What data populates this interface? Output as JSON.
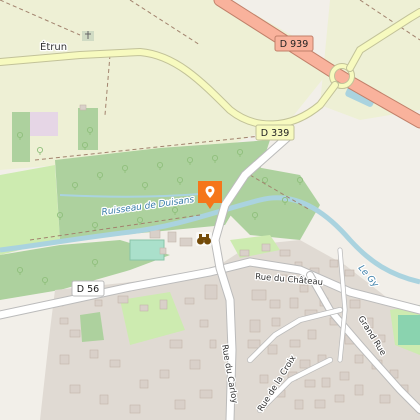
{
  "map": {
    "labels": {
      "village_north": "Étrun",
      "stream": "Ruisseau de Duisans",
      "river": "Le Gy",
      "street_chateau": "Rue du Château",
      "street_carloy": "Rue du Carloy",
      "street_croix": "Rue de la Croix",
      "street_grand": "Grand Rue"
    },
    "road_shields": {
      "d939": "D 939",
      "d339": "D 339",
      "d56": "D 56"
    },
    "marker": {
      "icon": "map-pin-icon",
      "color": "#f5761a"
    },
    "poi": {
      "icon": "binoculars-icon"
    },
    "colors": {
      "background": "#f2efe9",
      "meadow": "#eef0d5",
      "forest": "#add19e",
      "grass": "#cdebb0",
      "water": "#aad3df",
      "built": "#d9d0c9",
      "trunk_road": "#f9b29c",
      "secondary_road": "#f7fabf",
      "marker": "#f5761a"
    }
  }
}
